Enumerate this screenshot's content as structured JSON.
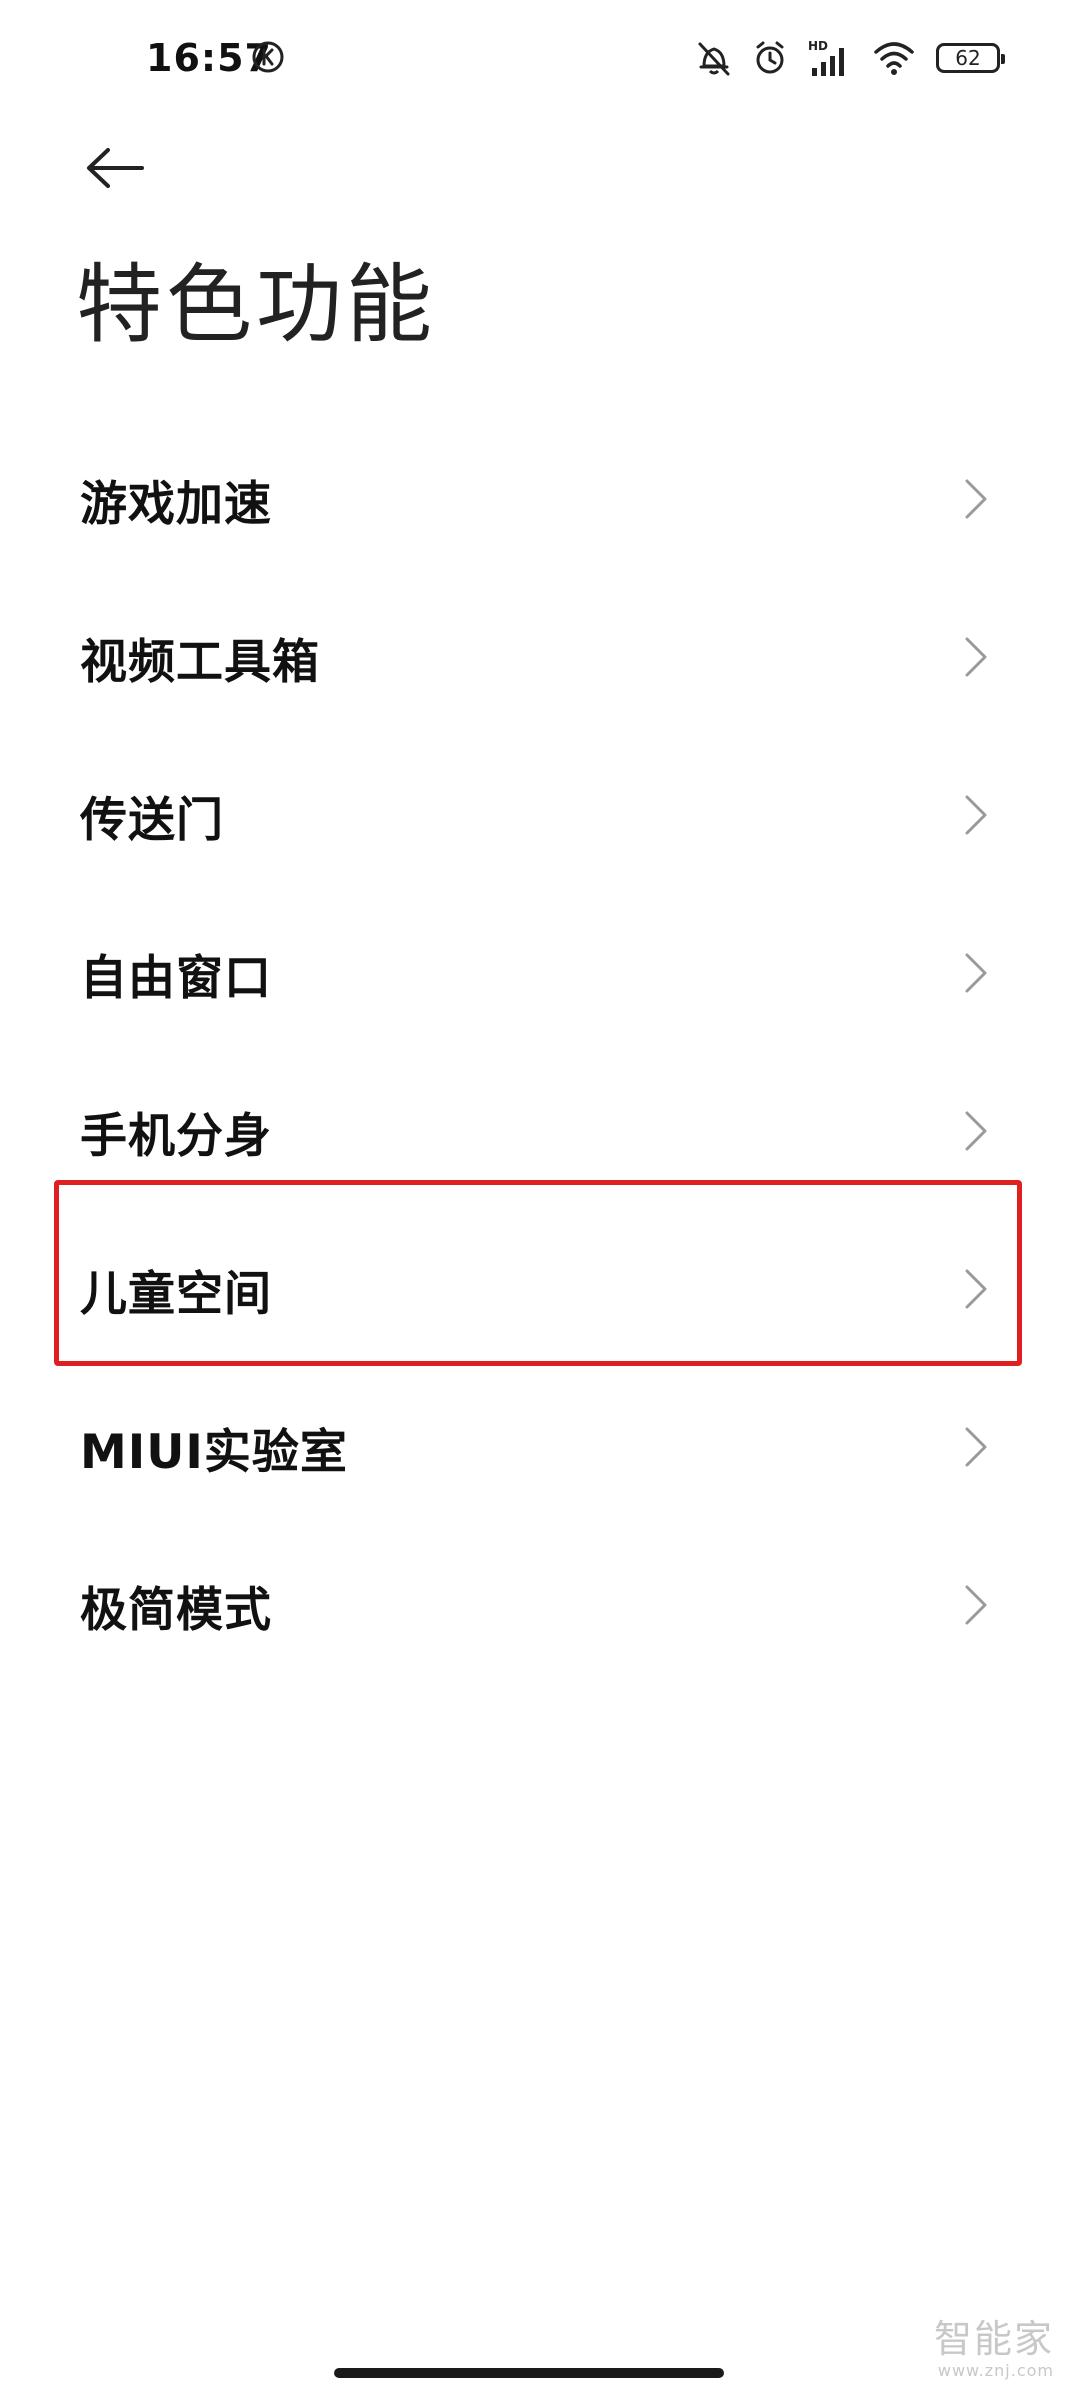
{
  "status_bar": {
    "time": "16:57",
    "battery_level": "62",
    "network_label": "HD"
  },
  "header": {
    "title": "特色功能"
  },
  "menu": {
    "items": [
      {
        "label": "游戏加速"
      },
      {
        "label": "视频工具箱"
      },
      {
        "label": "传送门"
      },
      {
        "label": "自由窗口"
      },
      {
        "label": "手机分身"
      },
      {
        "label": "儿童空间"
      },
      {
        "label": "MIUI实验室"
      },
      {
        "label": "极简模式"
      }
    ],
    "highlighted_item": "儿童空间"
  },
  "watermark": {
    "main": "智能家",
    "sub": "www.znj.com"
  },
  "colors": {
    "highlight_border": "#e02020",
    "chevron": "#9a9a9a",
    "text_primary": "#111111"
  }
}
